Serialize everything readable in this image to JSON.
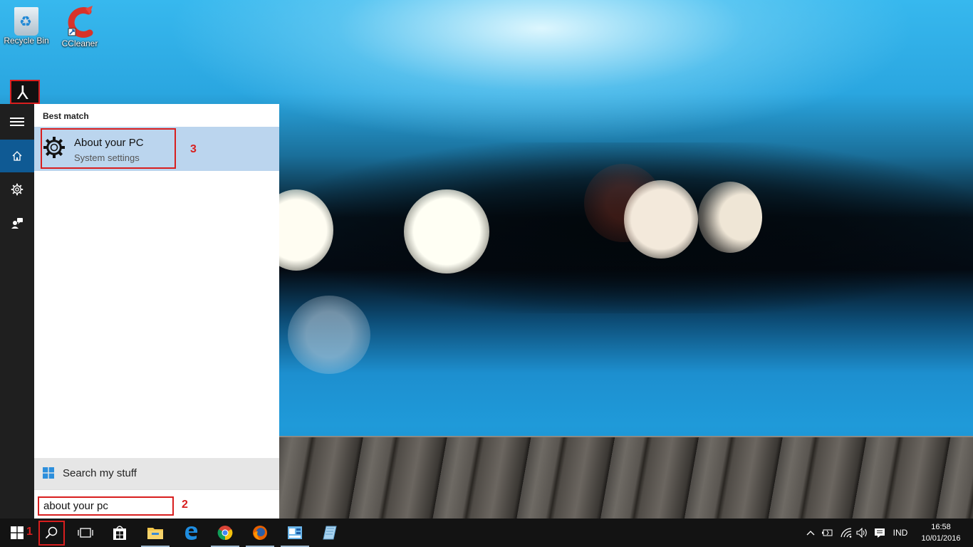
{
  "desktop": {
    "icons": [
      {
        "label": "Recycle Bin",
        "icon": "recycle-bin-icon"
      },
      {
        "label": "CCleaner",
        "icon": "ccleaner-icon"
      }
    ],
    "pinned_icon": "acrobat-icon"
  },
  "start_rail": {
    "items": [
      "menu-icon",
      "home-icon",
      "settings-icon",
      "feedback-icon"
    ]
  },
  "search_panel": {
    "section_label": "Best match",
    "best_match": {
      "title": "About your PC",
      "subtitle": "System settings",
      "icon": "gear-icon"
    },
    "search_my_stuff": "Search my stuff",
    "query": "about your pc"
  },
  "annotations": {
    "step1": "1",
    "step2": "2",
    "step3": "3",
    "color": "#d81e1e"
  },
  "taskbar": {
    "apps": [
      "start-icon",
      "search-icon",
      "task-view-icon",
      "store-icon",
      "file-explorer-icon",
      "edge-icon",
      "chrome-icon",
      "firefox-icon",
      "app-icon",
      "notes-icon"
    ],
    "language": "IND",
    "time": "16:58",
    "date": "10/01/2016"
  },
  "colors": {
    "accent": "#0f5a94",
    "selection": "#bbd5ee",
    "taskbar": "#131313"
  }
}
